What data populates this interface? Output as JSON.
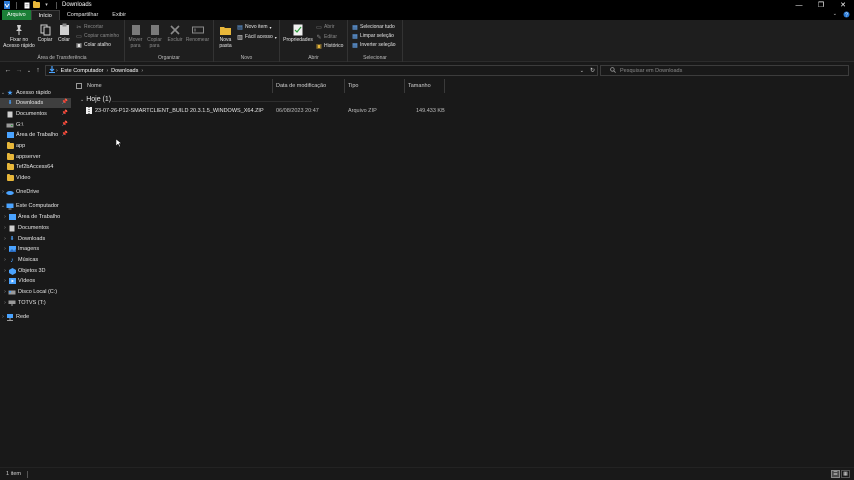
{
  "window": {
    "title": "Downloads",
    "controls": {
      "minimize": "—",
      "maximize": "❐",
      "close": "✕"
    }
  },
  "ribbon_tabs": [
    {
      "label": "Arquivo"
    },
    {
      "label": "Início"
    },
    {
      "label": "Compartilhar"
    },
    {
      "label": "Exibir"
    }
  ],
  "ribbon": {
    "clipboard": {
      "pin_label": "Fixar no\nAcesso rápido",
      "copy_label": "Copiar",
      "paste_label": "Colar",
      "cut_label": "Recortar",
      "copy_path_label": "Copiar caminho",
      "paste_shortcut_label": "Colar atalho",
      "group_label": "Área de Transferência"
    },
    "organize": {
      "move_label": "Mover\npara",
      "copy_to_label": "Copiar\npara",
      "delete_label": "Excluir",
      "rename_label": "Renomear",
      "group_label": "Organizar"
    },
    "new": {
      "new_folder_label": "Nova\npasta",
      "new_item_label": "Novo item",
      "easy_access_label": "Fácil acesso",
      "group_label": "Novo"
    },
    "open": {
      "properties_label": "Propriedades",
      "open_label": "Abrir",
      "edit_label": "Editar",
      "history_label": "Histórico",
      "group_label": "Abrir"
    },
    "select": {
      "select_all_label": "Selecionar tudo",
      "select_none_label": "Limpar seleção",
      "invert_label": "Inverter seleção",
      "group_label": "Selecionar"
    }
  },
  "address": {
    "crumbs": [
      "Este Computador",
      "Downloads"
    ],
    "search_placeholder": "Pesquisar em Downloads"
  },
  "nav": {
    "quick_access": "Acesso rápido",
    "quick_items": [
      {
        "label": "Downloads",
        "pinned": true
      },
      {
        "label": "Documentos",
        "pinned": true
      },
      {
        "label": "G:\\",
        "pinned": true
      },
      {
        "label": "Área de Trabalho",
        "pinned": true
      },
      {
        "label": "app"
      },
      {
        "label": "appserver"
      },
      {
        "label": "Tef2bAccess64"
      },
      {
        "label": "Vídeo"
      }
    ],
    "onedrive": "OneDrive",
    "this_pc": "Este Computador",
    "pc_items": [
      {
        "label": "Área de Trabalho"
      },
      {
        "label": "Documentos"
      },
      {
        "label": "Downloads"
      },
      {
        "label": "Imagens"
      },
      {
        "label": "Músicas"
      },
      {
        "label": "Objetos 3D"
      },
      {
        "label": "Vídeos"
      },
      {
        "label": "Disco Local (C:)"
      },
      {
        "label": "TOTVS (T:)"
      }
    ],
    "network": "Rede"
  },
  "columns": {
    "name": "Nome",
    "date": "Data de modificação",
    "type": "Tipo",
    "size": "Tamanho"
  },
  "group": {
    "title": "Hoje (1)"
  },
  "files": [
    {
      "name": "23-07-26-P12-SMARTCLIENT_BUILD 20.3.1.5_WINDOWS_X64.ZIP",
      "date": "06/08/2023 20:47",
      "type": "Arquivo ZIP",
      "size": "149.433 KB"
    }
  ],
  "status": {
    "count": "1 item"
  }
}
